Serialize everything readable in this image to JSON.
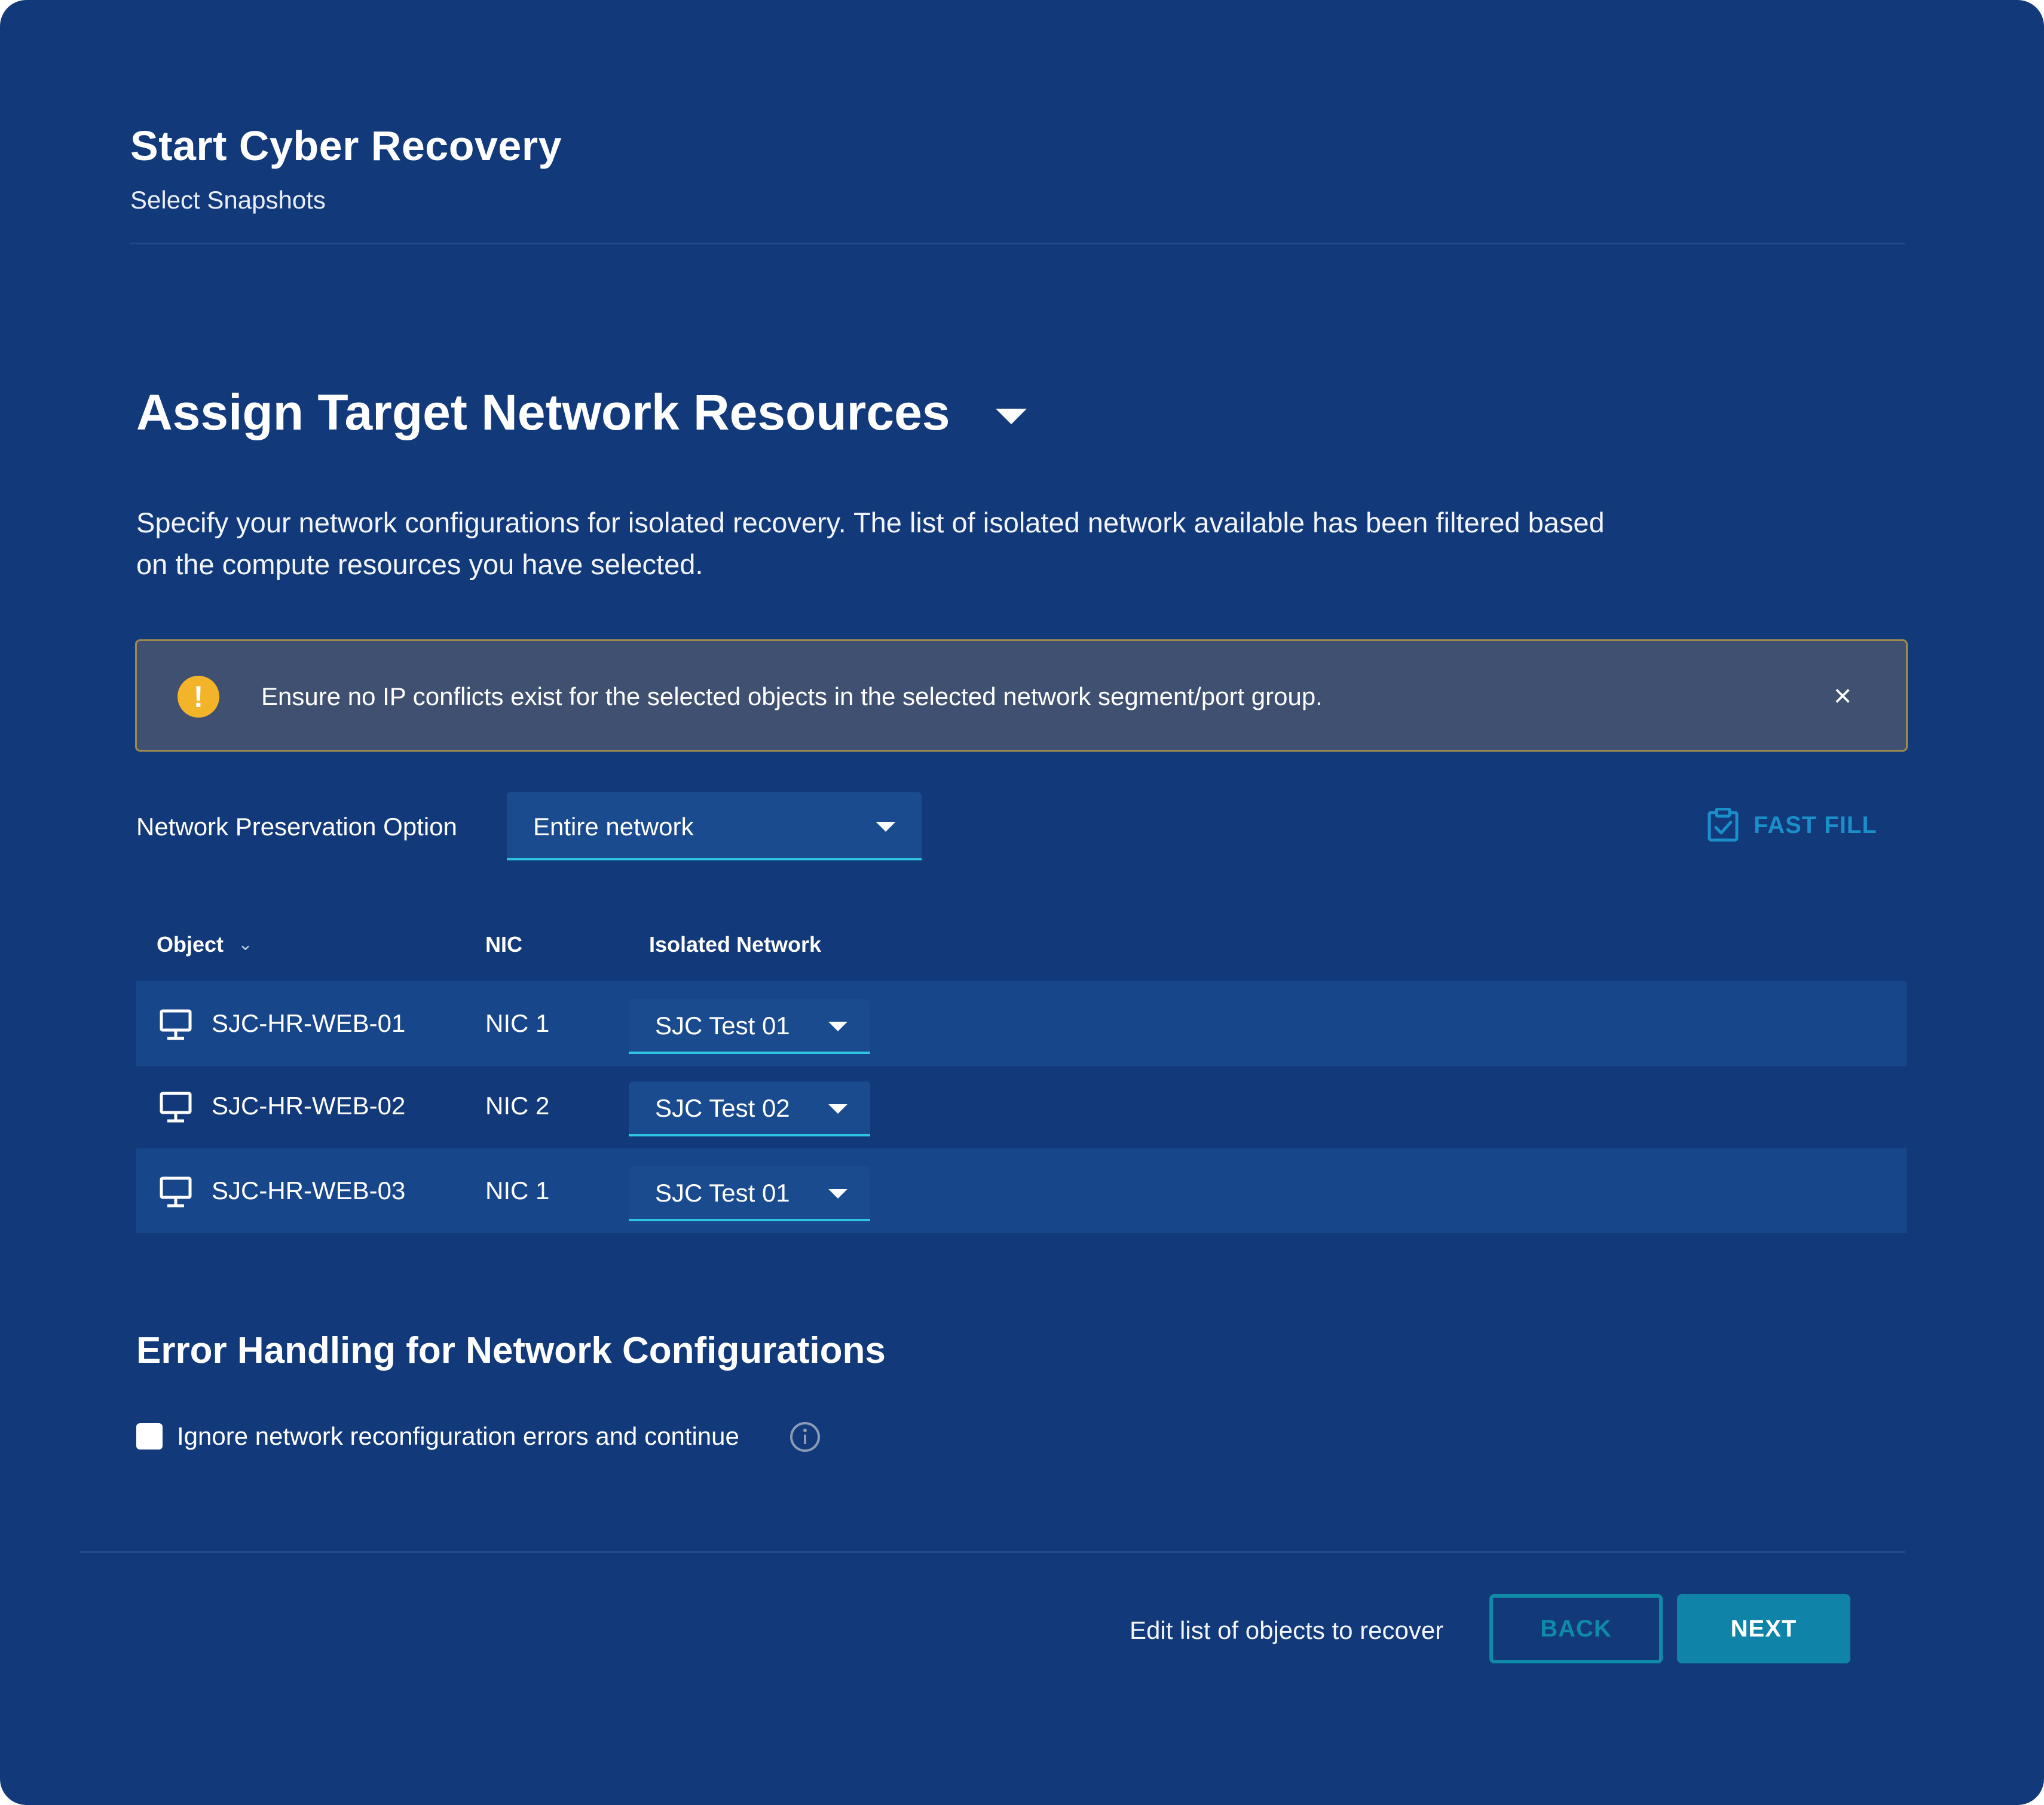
{
  "header": {
    "title": "Start Cyber Recovery",
    "subtitle": "Select Snapshots"
  },
  "section": {
    "title": "Assign Target Network Resources",
    "description": "Specify your network configurations for isolated recovery. The list of isolated network available has been filtered based on the compute resources you have selected."
  },
  "alert": {
    "icon": "warning-icon",
    "text": "Ensure no IP conflicts exist for the selected objects in the selected network segment/port group.",
    "close_label": "×"
  },
  "network_preservation": {
    "label": "Network Preservation Option",
    "selected": "Entire network"
  },
  "fast_fill": {
    "label": "FAST FILL",
    "icon": "clipboard-check-icon"
  },
  "table": {
    "columns": [
      "Object",
      "NIC",
      "Isolated Network"
    ],
    "rows": [
      {
        "object": "SJC-HR-WEB-01",
        "nic": "NIC 1",
        "network": "SJC Test 01"
      },
      {
        "object": "SJC-HR-WEB-02",
        "nic": "NIC 2",
        "network": "SJC Test 02"
      },
      {
        "object": "SJC-HR-WEB-03",
        "nic": "NIC 1",
        "network": "SJC Test 01"
      }
    ]
  },
  "error_handling": {
    "title": "Error Handling for Network Configurations",
    "checkbox_label": "Ignore network reconfiguration errors and continue",
    "checked": false
  },
  "footer": {
    "edit_link": "Edit list of objects to recover",
    "back_label": "BACK",
    "next_label": "NEXT"
  },
  "colors": {
    "background": "#12397a",
    "accent": "#0f83a8",
    "warning": "#f4b42a"
  }
}
